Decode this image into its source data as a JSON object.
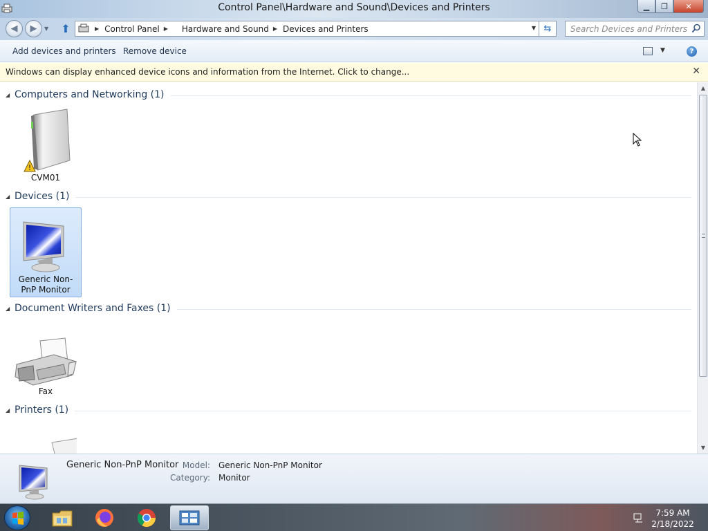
{
  "window": {
    "title": "Control Panel\\Hardware and Sound\\Devices and Printers",
    "buttons": {
      "minimize": "▁",
      "maximize": "❐",
      "close": "✕"
    }
  },
  "address": {
    "crumbs": [
      "Control Panel",
      "Hardware and Sound",
      "Devices and Printers"
    ],
    "search_placeholder": "Search Devices and Printers"
  },
  "commands": {
    "add": "Add devices and printers",
    "remove": "Remove device",
    "help": "?"
  },
  "infobar": {
    "message": "Windows can display enhanced device icons and information from the Internet. Click to change...",
    "close": "✕"
  },
  "groups": [
    {
      "title": "Computers and Networking (1)",
      "items": [
        {
          "label": "CVM01",
          "icon": "computer-tower-warning-icon"
        }
      ]
    },
    {
      "title": "Devices (1)",
      "items": [
        {
          "label": "Generic Non-PnP Monitor",
          "icon": "monitor-icon",
          "selected": true
        }
      ]
    },
    {
      "title": "Document Writers and Faxes (1)",
      "items": [
        {
          "label": "Fax",
          "icon": "fax-icon"
        }
      ]
    },
    {
      "title": "Printers (1)",
      "items": [
        {
          "label": "",
          "icon": "printer-icon"
        }
      ]
    }
  ],
  "details": {
    "name": "Generic Non-PnP Monitor",
    "model_label": "Model:",
    "model_value": "Generic Non-PnP Monitor",
    "category_label": "Category:",
    "category_value": "Monitor"
  },
  "taskbar": {
    "items": [
      "start-orb",
      "file-explorer",
      "firefox",
      "chrome",
      "devices-and-printers"
    ],
    "time": "7:59 AM",
    "date": "2/18/2022"
  },
  "colors": {
    "group_title": "#1e395b",
    "selection": "#c1dbf8",
    "infobar": "#fffbe0"
  }
}
